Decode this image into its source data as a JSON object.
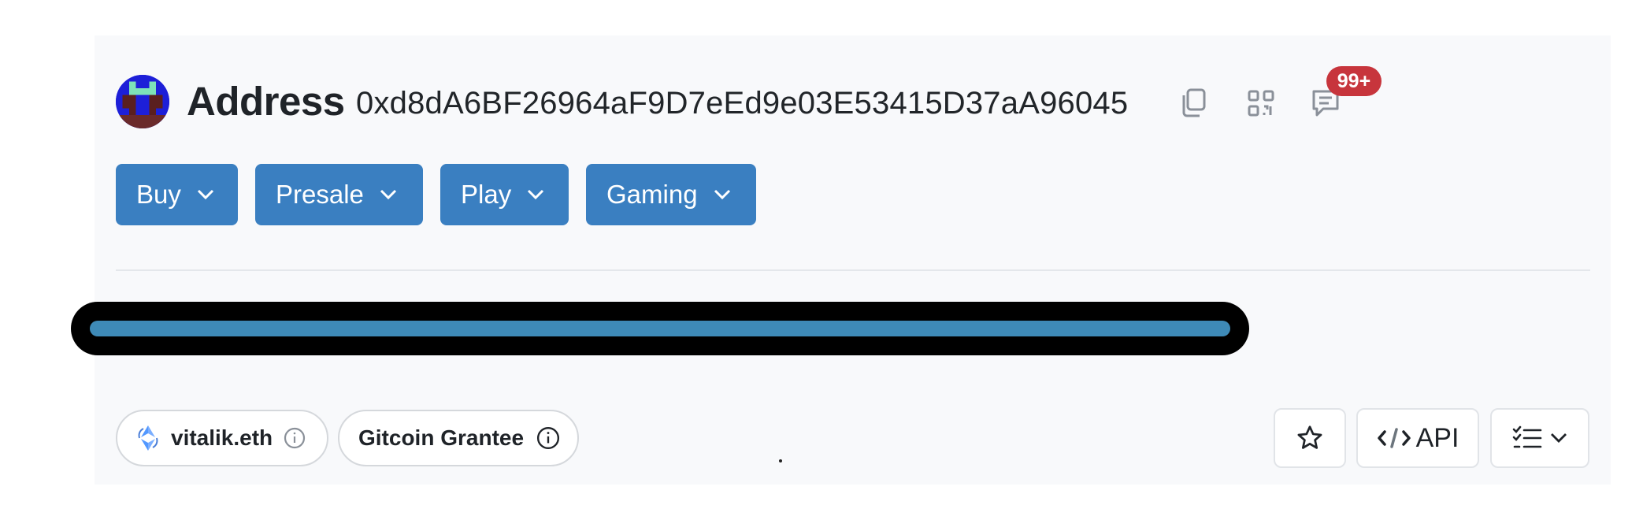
{
  "header": {
    "title": "Address",
    "address": "0xd8dA6BF26964aF9D7eEd9e03E53415D37aA96045",
    "comment_badge": "99+",
    "icons": [
      "avatar",
      "copy-icon",
      "qr-code-icon",
      "comment-icon"
    ]
  },
  "action_buttons": [
    {
      "label": "Buy"
    },
    {
      "label": "Presale"
    },
    {
      "label": "Play"
    },
    {
      "label": "Gaming"
    }
  ],
  "progress": {
    "fraction": 0.97
  },
  "tags": [
    {
      "label": "vitalik.eth",
      "icon": "ens-icon",
      "info_icon": "info-icon"
    },
    {
      "label": "Gitcoin Grantee",
      "info_icon": "info-icon"
    }
  ],
  "toolbar": {
    "api_label": "API",
    "icons": [
      "star-icon",
      "code-icon",
      "checklist-icon",
      "chevron-down-icon"
    ]
  },
  "colors": {
    "accent": "#3a7fc1",
    "badge": "#c7353c",
    "progress_fill": "#3e8ab7",
    "panel_bg": "#f8f9fb"
  }
}
